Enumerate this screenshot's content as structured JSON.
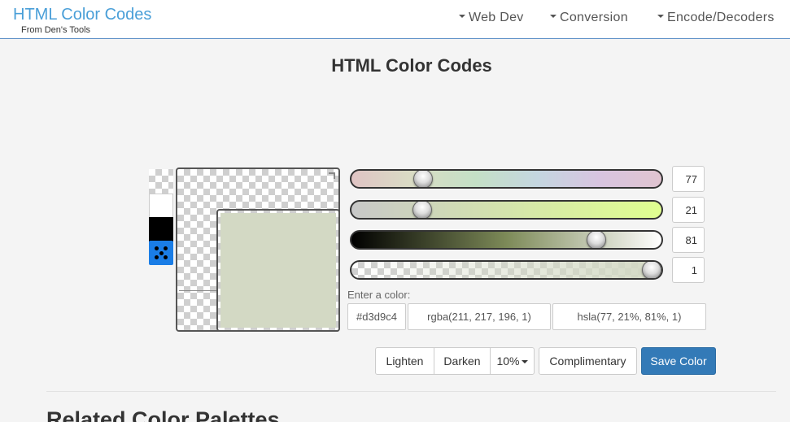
{
  "header": {
    "brand": "HTML Color Codes",
    "brand_sub": "From Den's Tools",
    "nav": [
      "Web Dev",
      "Conversion",
      "Encode/Decoders"
    ]
  },
  "page_title": "HTML Color Codes",
  "color": {
    "current_hex_color": "#d3d9c4",
    "swatches": [
      "transparent-icon",
      "white-swatch",
      "black-swatch",
      "random-dice-icon"
    ]
  },
  "sliders": {
    "hue": "77",
    "saturation": "21",
    "lightness": "81",
    "alpha": "1",
    "hue_fraction": 0.214,
    "saturation_fraction": 0.21,
    "lightness_fraction": 0.81,
    "alpha_fraction": 1.0
  },
  "inputs": {
    "label": "Enter a color:",
    "hex": "#d3d9c4",
    "rgba": "rgba(211, 217, 196, 1)",
    "hsla": "hsla(77, 21%, 81%, 1)"
  },
  "buttons": {
    "lighten": "Lighten",
    "darken": "Darken",
    "percent": "10%",
    "complimentary": "Complimentary",
    "save": "Save Color"
  },
  "related_title": "Related Color Palettes",
  "colors": {
    "brand": "#4a9fd8",
    "accent": "#337ab7"
  }
}
